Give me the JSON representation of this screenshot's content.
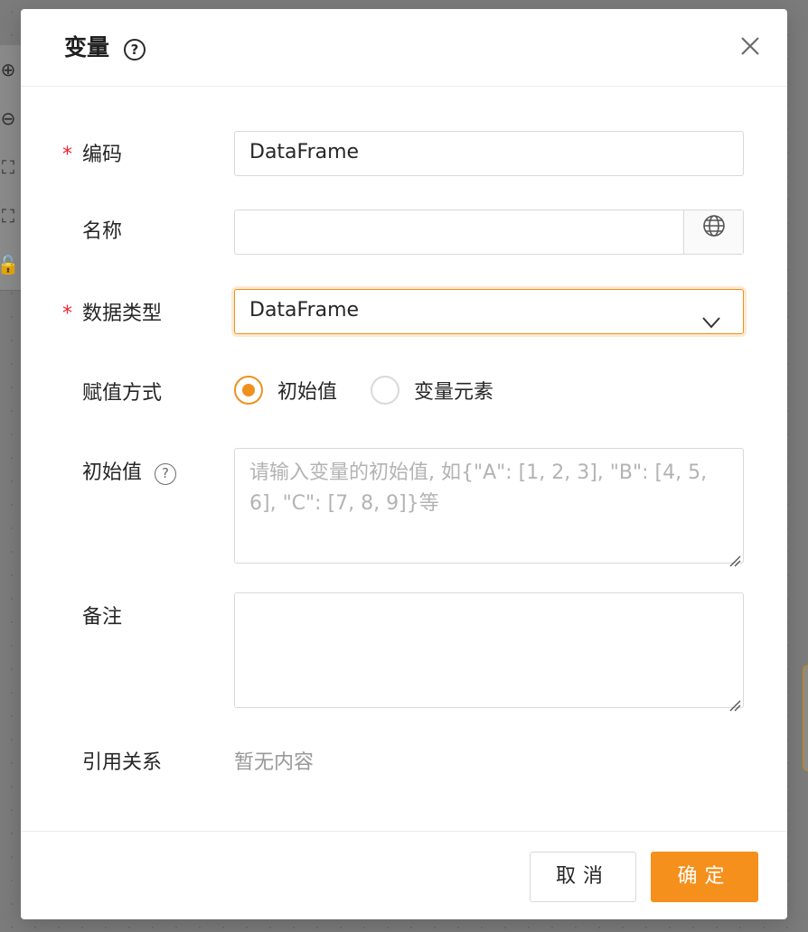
{
  "dialog": {
    "title": "变量",
    "help_glyph": "?"
  },
  "form": {
    "code": {
      "label": "编码",
      "required_mark": "*",
      "value": "DataFrame"
    },
    "name": {
      "label": "名称",
      "value": "",
      "addon_icon": "globe-icon"
    },
    "data_type": {
      "label": "数据类型",
      "required_mark": "*",
      "selected": "DataFrame",
      "arrow_icon": "chevron-down-icon"
    },
    "assign_mode": {
      "label": "赋值方式",
      "options": [
        {
          "label": "初始值",
          "checked": true
        },
        {
          "label": "变量元素",
          "checked": false
        }
      ]
    },
    "initial_value": {
      "label": "初始值",
      "help_glyph": "?",
      "placeholder": "请输入变量的初始值, 如{\"A\": [1, 2, 3], \"B\": [4, 5, 6], \"C\": [7, 8, 9]}等"
    },
    "remark": {
      "label": "备注",
      "value": ""
    },
    "references": {
      "label": "引用关系",
      "empty_text": "暂无内容"
    }
  },
  "footer": {
    "cancel_label": "取消",
    "ok_label": "确定"
  },
  "colors": {
    "accent": "#f5901c",
    "required": "#f5222d"
  }
}
